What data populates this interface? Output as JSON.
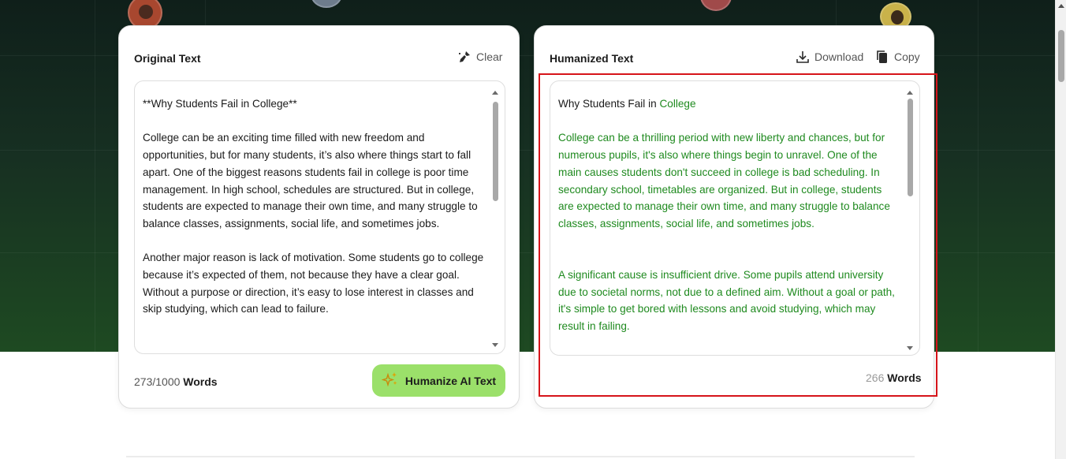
{
  "original": {
    "title": "Original Text",
    "clear_label": "Clear",
    "paragraphs": [
      "**Why Students Fail in College**",
      "College can be an exciting time filled with new freedom and opportunities, but for many students, it’s also where things start to fall apart. One of the biggest reasons students fail in college is poor time management. In high school, schedules are structured. But in college, students are expected to manage their own time, and many struggle to balance classes, assignments, social life, and sometimes jobs.",
      "Another major reason is lack of motivation. Some students go to college because it’s expected of them, not because they have a clear goal. Without a purpose or direction, it’s easy to lose interest in classes and skip studying, which can lead to failure."
    ],
    "word_count": "273/1000",
    "word_unit": "Words",
    "humanize_label": "Humanize AI Text"
  },
  "humanized": {
    "title": "Humanized Text",
    "download_label": "Download",
    "copy_label": "Copy",
    "heading_dark": "Why Students Fail in",
    "heading_green": "College",
    "paragraphs": [
      "College can be a thrilling period with new liberty and chances, but for numerous pupils, it's also where things begin to unravel. One of the main causes students don't succeed in college is bad scheduling. In secondary school, timetables are organized. But in college, students are expected to manage their own time, and many struggle to balance classes, assignments, social life, and sometimes jobs.",
      "A significant cause is insufficient drive. Some pupils attend university due to societal norms, not due to a defined aim. Without a goal or path, it's simple to get bored with lessons and avoid studying, which may result in failing."
    ],
    "word_count": "266",
    "word_unit": "Words"
  },
  "colors": {
    "accent_green": "#9be06a",
    "highlight_red": "#d6141a",
    "humanized_text": "#1f8a1f"
  },
  "icons": [
    "brush-icon",
    "download-icon",
    "copy-icon",
    "sparkle-icon"
  ]
}
